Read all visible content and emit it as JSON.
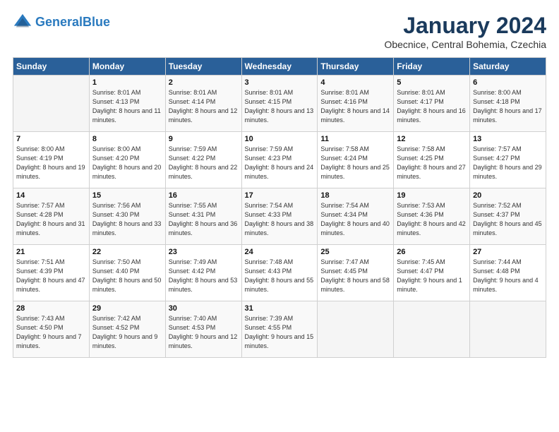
{
  "header": {
    "logo_line1": "General",
    "logo_line2": "Blue",
    "month": "January 2024",
    "location": "Obecnice, Central Bohemia, Czechia"
  },
  "weekdays": [
    "Sunday",
    "Monday",
    "Tuesday",
    "Wednesday",
    "Thursday",
    "Friday",
    "Saturday"
  ],
  "weeks": [
    [
      {
        "day": "",
        "sunrise": "",
        "sunset": "",
        "daylight": ""
      },
      {
        "day": "1",
        "sunrise": "Sunrise: 8:01 AM",
        "sunset": "Sunset: 4:13 PM",
        "daylight": "Daylight: 8 hours and 11 minutes."
      },
      {
        "day": "2",
        "sunrise": "Sunrise: 8:01 AM",
        "sunset": "Sunset: 4:14 PM",
        "daylight": "Daylight: 8 hours and 12 minutes."
      },
      {
        "day": "3",
        "sunrise": "Sunrise: 8:01 AM",
        "sunset": "Sunset: 4:15 PM",
        "daylight": "Daylight: 8 hours and 13 minutes."
      },
      {
        "day": "4",
        "sunrise": "Sunrise: 8:01 AM",
        "sunset": "Sunset: 4:16 PM",
        "daylight": "Daylight: 8 hours and 14 minutes."
      },
      {
        "day": "5",
        "sunrise": "Sunrise: 8:01 AM",
        "sunset": "Sunset: 4:17 PM",
        "daylight": "Daylight: 8 hours and 16 minutes."
      },
      {
        "day": "6",
        "sunrise": "Sunrise: 8:00 AM",
        "sunset": "Sunset: 4:18 PM",
        "daylight": "Daylight: 8 hours and 17 minutes."
      }
    ],
    [
      {
        "day": "7",
        "sunrise": "Sunrise: 8:00 AM",
        "sunset": "Sunset: 4:19 PM",
        "daylight": "Daylight: 8 hours and 19 minutes."
      },
      {
        "day": "8",
        "sunrise": "Sunrise: 8:00 AM",
        "sunset": "Sunset: 4:20 PM",
        "daylight": "Daylight: 8 hours and 20 minutes."
      },
      {
        "day": "9",
        "sunrise": "Sunrise: 7:59 AM",
        "sunset": "Sunset: 4:22 PM",
        "daylight": "Daylight: 8 hours and 22 minutes."
      },
      {
        "day": "10",
        "sunrise": "Sunrise: 7:59 AM",
        "sunset": "Sunset: 4:23 PM",
        "daylight": "Daylight: 8 hours and 24 minutes."
      },
      {
        "day": "11",
        "sunrise": "Sunrise: 7:58 AM",
        "sunset": "Sunset: 4:24 PM",
        "daylight": "Daylight: 8 hours and 25 minutes."
      },
      {
        "day": "12",
        "sunrise": "Sunrise: 7:58 AM",
        "sunset": "Sunset: 4:25 PM",
        "daylight": "Daylight: 8 hours and 27 minutes."
      },
      {
        "day": "13",
        "sunrise": "Sunrise: 7:57 AM",
        "sunset": "Sunset: 4:27 PM",
        "daylight": "Daylight: 8 hours and 29 minutes."
      }
    ],
    [
      {
        "day": "14",
        "sunrise": "Sunrise: 7:57 AM",
        "sunset": "Sunset: 4:28 PM",
        "daylight": "Daylight: 8 hours and 31 minutes."
      },
      {
        "day": "15",
        "sunrise": "Sunrise: 7:56 AM",
        "sunset": "Sunset: 4:30 PM",
        "daylight": "Daylight: 8 hours and 33 minutes."
      },
      {
        "day": "16",
        "sunrise": "Sunrise: 7:55 AM",
        "sunset": "Sunset: 4:31 PM",
        "daylight": "Daylight: 8 hours and 36 minutes."
      },
      {
        "day": "17",
        "sunrise": "Sunrise: 7:54 AM",
        "sunset": "Sunset: 4:33 PM",
        "daylight": "Daylight: 8 hours and 38 minutes."
      },
      {
        "day": "18",
        "sunrise": "Sunrise: 7:54 AM",
        "sunset": "Sunset: 4:34 PM",
        "daylight": "Daylight: 8 hours and 40 minutes."
      },
      {
        "day": "19",
        "sunrise": "Sunrise: 7:53 AM",
        "sunset": "Sunset: 4:36 PM",
        "daylight": "Daylight: 8 hours and 42 minutes."
      },
      {
        "day": "20",
        "sunrise": "Sunrise: 7:52 AM",
        "sunset": "Sunset: 4:37 PM",
        "daylight": "Daylight: 8 hours and 45 minutes."
      }
    ],
    [
      {
        "day": "21",
        "sunrise": "Sunrise: 7:51 AM",
        "sunset": "Sunset: 4:39 PM",
        "daylight": "Daylight: 8 hours and 47 minutes."
      },
      {
        "day": "22",
        "sunrise": "Sunrise: 7:50 AM",
        "sunset": "Sunset: 4:40 PM",
        "daylight": "Daylight: 8 hours and 50 minutes."
      },
      {
        "day": "23",
        "sunrise": "Sunrise: 7:49 AM",
        "sunset": "Sunset: 4:42 PM",
        "daylight": "Daylight: 8 hours and 53 minutes."
      },
      {
        "day": "24",
        "sunrise": "Sunrise: 7:48 AM",
        "sunset": "Sunset: 4:43 PM",
        "daylight": "Daylight: 8 hours and 55 minutes."
      },
      {
        "day": "25",
        "sunrise": "Sunrise: 7:47 AM",
        "sunset": "Sunset: 4:45 PM",
        "daylight": "Daylight: 8 hours and 58 minutes."
      },
      {
        "day": "26",
        "sunrise": "Sunrise: 7:45 AM",
        "sunset": "Sunset: 4:47 PM",
        "daylight": "Daylight: 9 hours and 1 minute."
      },
      {
        "day": "27",
        "sunrise": "Sunrise: 7:44 AM",
        "sunset": "Sunset: 4:48 PM",
        "daylight": "Daylight: 9 hours and 4 minutes."
      }
    ],
    [
      {
        "day": "28",
        "sunrise": "Sunrise: 7:43 AM",
        "sunset": "Sunset: 4:50 PM",
        "daylight": "Daylight: 9 hours and 7 minutes."
      },
      {
        "day": "29",
        "sunrise": "Sunrise: 7:42 AM",
        "sunset": "Sunset: 4:52 PM",
        "daylight": "Daylight: 9 hours and 9 minutes."
      },
      {
        "day": "30",
        "sunrise": "Sunrise: 7:40 AM",
        "sunset": "Sunset: 4:53 PM",
        "daylight": "Daylight: 9 hours and 12 minutes."
      },
      {
        "day": "31",
        "sunrise": "Sunrise: 7:39 AM",
        "sunset": "Sunset: 4:55 PM",
        "daylight": "Daylight: 9 hours and 15 minutes."
      },
      {
        "day": "",
        "sunrise": "",
        "sunset": "",
        "daylight": ""
      },
      {
        "day": "",
        "sunrise": "",
        "sunset": "",
        "daylight": ""
      },
      {
        "day": "",
        "sunrise": "",
        "sunset": "",
        "daylight": ""
      }
    ]
  ]
}
